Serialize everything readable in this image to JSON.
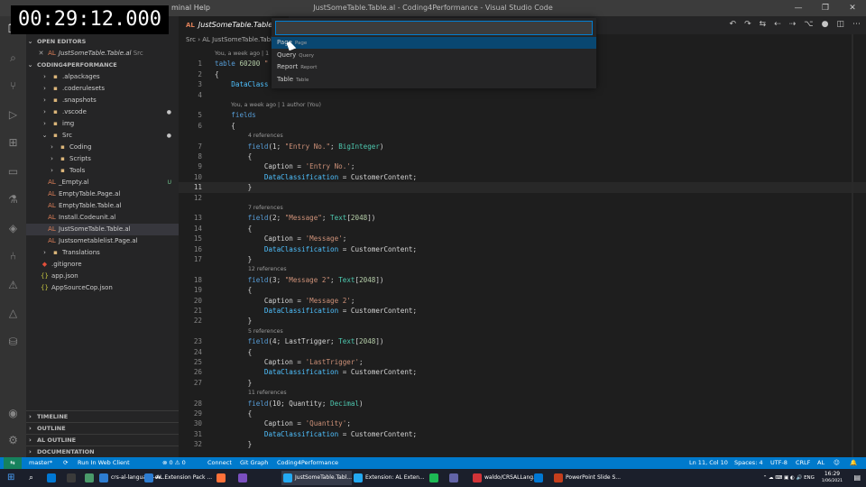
{
  "timer": "00:29:12.000",
  "titlebar": {
    "menu": "minal   Help",
    "title": "JustSomeTable.Table.al - Coding4Performance - Visual Studio Code",
    "controls": [
      "—",
      "❐",
      "✕"
    ]
  },
  "activity_icons": [
    "files-icon",
    "search-icon",
    "source-control-icon",
    "run-debug-icon",
    "extensions-icon",
    "remote-icon",
    "test-icon",
    "docker-icon",
    "git-graph-icon",
    "warning-icon",
    "triangle-icon",
    "database-icon",
    "account-icon",
    "settings-gear-icon"
  ],
  "sidebar": {
    "open_editors_header": "OPEN EDITORS",
    "open_editor": "JustSomeTable.Table.al",
    "open_editor_path": "Src",
    "workspace_header": "CODING4PERFORMANCE",
    "tree": [
      {
        "label": ".alpackages",
        "icon": "›",
        "kind": "folder"
      },
      {
        "label": ".coderulesets",
        "icon": "›",
        "kind": "folder"
      },
      {
        "label": ".snapshots",
        "icon": "›",
        "kind": "folder"
      },
      {
        "label": ".vscode",
        "icon": "›",
        "kind": "folder",
        "badge": "●"
      },
      {
        "label": "img",
        "icon": "›",
        "kind": "folder"
      },
      {
        "label": "Src",
        "icon": "⌄",
        "kind": "folder",
        "badge": "●"
      },
      {
        "label": "Coding",
        "icon": "›",
        "kind": "folder"
      },
      {
        "label": "Scripts",
        "icon": "›",
        "kind": "folder"
      },
      {
        "label": "Tools",
        "icon": "›",
        "kind": "folder"
      },
      {
        "label": "_Empty.al",
        "icon": "AL",
        "kind": "al",
        "badge": "U"
      },
      {
        "label": "EmptyTable.Page.al",
        "icon": "AL",
        "kind": "al"
      },
      {
        "label": "EmptyTable.Table.al",
        "icon": "AL",
        "kind": "al"
      },
      {
        "label": "Install.Codeunit.al",
        "icon": "AL",
        "kind": "al"
      },
      {
        "label": "JustSomeTable.Table.al",
        "icon": "AL",
        "kind": "al",
        "selected": true
      },
      {
        "label": "Justsometablelist.Page.al",
        "icon": "AL",
        "kind": "al"
      },
      {
        "label": "Translations",
        "icon": "›",
        "kind": "folder"
      },
      {
        "label": ".gitignore",
        "icon": "◆",
        "kind": "file"
      },
      {
        "label": "app.json",
        "icon": "{}",
        "kind": "json"
      },
      {
        "label": "AppSourceCop.json",
        "icon": "{}",
        "kind": "json"
      }
    ],
    "bottom_sections": [
      "TIMELINE",
      "OUTLINE",
      "AL OUTLINE",
      "DOCUMENTATION"
    ]
  },
  "editor": {
    "tab_prefix": "AL",
    "tab_label": "JustSomeTable.Table.al",
    "breadcrumb": "Src › AL JustSomeTable.Table.al",
    "actions": [
      "↶",
      "↷",
      "⇆",
      "⇠",
      "⇢",
      "⌥",
      "●",
      "◫",
      "⋯"
    ],
    "blame_top": "You, a week ago | 1",
    "blame_fields": "You, a week ago | 1 author (You)",
    "code": [
      {
        "n": "1",
        "parts": [
          [
            "kw",
            "table "
          ],
          [
            "num",
            "60200 "
          ],
          [
            "str",
            "\""
          ]
        ]
      },
      {
        "n": "2",
        "parts": [
          [
            "plain",
            "{"
          ]
        ]
      },
      {
        "n": "3",
        "parts": [
          [
            "plain",
            "    "
          ],
          [
            "prop",
            "DataClass"
          ]
        ]
      },
      {
        "n": "4",
        "parts": []
      },
      {
        "n": "5",
        "parts": [
          [
            "plain",
            "    "
          ],
          [
            "kw",
            "fields"
          ]
        ]
      },
      {
        "n": "6",
        "parts": [
          [
            "plain",
            "    {"
          ]
        ]
      },
      {
        "n": "7",
        "parts": [
          [
            "plain",
            "        "
          ],
          [
            "fn",
            "field"
          ],
          [
            "plain",
            "(1; "
          ],
          [
            "str",
            "\"Entry No.\""
          ],
          [
            "plain",
            "; "
          ],
          [
            "ty",
            "BigInteger"
          ],
          [
            "plain",
            ")"
          ]
        ]
      },
      {
        "n": "8",
        "parts": [
          [
            "plain",
            "        {"
          ]
        ]
      },
      {
        "n": "9",
        "parts": [
          [
            "plain",
            "            Caption = "
          ],
          [
            "str",
            "'Entry No.'"
          ],
          [
            "plain",
            ";"
          ]
        ]
      },
      {
        "n": "10",
        "parts": [
          [
            "plain",
            "            "
          ],
          [
            "prop",
            "DataClassification"
          ],
          [
            "plain",
            " = CustomerContent;"
          ]
        ]
      },
      {
        "n": "11",
        "parts": [
          [
            "plain",
            "        }"
          ]
        ]
      },
      {
        "n": "12",
        "parts": []
      },
      {
        "n": "13",
        "parts": [
          [
            "plain",
            "        "
          ],
          [
            "fn",
            "field"
          ],
          [
            "plain",
            "(2; "
          ],
          [
            "str",
            "\"Message\""
          ],
          [
            "plain",
            "; "
          ],
          [
            "ty",
            "Text"
          ],
          [
            "plain",
            "["
          ],
          [
            "num",
            "2048"
          ],
          [
            "plain",
            "])"
          ]
        ]
      },
      {
        "n": "14",
        "parts": [
          [
            "plain",
            "        {"
          ]
        ]
      },
      {
        "n": "15",
        "parts": [
          [
            "plain",
            "            Caption = "
          ],
          [
            "str",
            "'Message'"
          ],
          [
            "plain",
            ";"
          ]
        ]
      },
      {
        "n": "16",
        "parts": [
          [
            "plain",
            "            "
          ],
          [
            "prop",
            "DataClassification"
          ],
          [
            "plain",
            " = CustomerContent;"
          ]
        ]
      },
      {
        "n": "17",
        "parts": [
          [
            "plain",
            "        }"
          ]
        ]
      },
      {
        "n": "18",
        "parts": [
          [
            "plain",
            "        "
          ],
          [
            "fn",
            "field"
          ],
          [
            "plain",
            "(3; "
          ],
          [
            "str",
            "\"Message 2\""
          ],
          [
            "plain",
            "; "
          ],
          [
            "ty",
            "Text"
          ],
          [
            "plain",
            "["
          ],
          [
            "num",
            "2048"
          ],
          [
            "plain",
            "])"
          ]
        ]
      },
      {
        "n": "19",
        "parts": [
          [
            "plain",
            "        {"
          ]
        ]
      },
      {
        "n": "20",
        "parts": [
          [
            "plain",
            "            Caption = "
          ],
          [
            "str",
            "'Message 2'"
          ],
          [
            "plain",
            ";"
          ]
        ]
      },
      {
        "n": "21",
        "parts": [
          [
            "plain",
            "            "
          ],
          [
            "prop",
            "DataClassification"
          ],
          [
            "plain",
            " = CustomerContent;"
          ]
        ]
      },
      {
        "n": "22",
        "parts": [
          [
            "plain",
            "        }"
          ]
        ]
      },
      {
        "n": "23",
        "parts": [
          [
            "plain",
            "        "
          ],
          [
            "fn",
            "field"
          ],
          [
            "plain",
            "(4; LastTrigger; "
          ],
          [
            "ty",
            "Text"
          ],
          [
            "plain",
            "["
          ],
          [
            "num",
            "2048"
          ],
          [
            "plain",
            "])"
          ]
        ]
      },
      {
        "n": "24",
        "parts": [
          [
            "plain",
            "        {"
          ]
        ]
      },
      {
        "n": "25",
        "parts": [
          [
            "plain",
            "            Caption = "
          ],
          [
            "str",
            "'LastTrigger'"
          ],
          [
            "plain",
            ";"
          ]
        ]
      },
      {
        "n": "26",
        "parts": [
          [
            "plain",
            "            "
          ],
          [
            "prop",
            "DataClassification"
          ],
          [
            "plain",
            " = CustomerContent;"
          ]
        ]
      },
      {
        "n": "27",
        "parts": [
          [
            "plain",
            "        }"
          ]
        ]
      },
      {
        "n": "28",
        "parts": [
          [
            "plain",
            "        "
          ],
          [
            "fn",
            "field"
          ],
          [
            "plain",
            "(10; Quantity; "
          ],
          [
            "ty",
            "Decimal"
          ],
          [
            "plain",
            ")"
          ]
        ]
      },
      {
        "n": "29",
        "parts": [
          [
            "plain",
            "        {"
          ]
        ]
      },
      {
        "n": "30",
        "parts": [
          [
            "plain",
            "            Caption = "
          ],
          [
            "str",
            "'Quantity'"
          ],
          [
            "plain",
            ";"
          ]
        ]
      },
      {
        "n": "31",
        "parts": [
          [
            "plain",
            "            "
          ],
          [
            "prop",
            "DataClassification"
          ],
          [
            "plain",
            " = CustomerContent;"
          ]
        ]
      },
      {
        "n": "32",
        "parts": [
          [
            "plain",
            "        }"
          ]
        ]
      }
    ],
    "code_lens": [
      {
        "text": "4 references"
      },
      {
        "text": "7 references"
      },
      {
        "text": "12 references"
      },
      {
        "text": "5 references"
      },
      {
        "text": "11 references"
      }
    ]
  },
  "palette": {
    "input_value": "",
    "items": [
      {
        "label": "Page",
        "kind": "Page",
        "selected": true
      },
      {
        "label": "Query",
        "kind": "Query"
      },
      {
        "label": "Report",
        "kind": "Report"
      },
      {
        "label": "Table",
        "kind": "Table"
      }
    ]
  },
  "statusbar": {
    "branch": "master*",
    "sync": "⟳",
    "problems": "⊗ 0 ⚠ 0",
    "run_web": "Run In Web Client",
    "connect": "Connect",
    "git_graph": "Git Graph",
    "project": "Coding4Performance",
    "position": "Ln 11, Col 10",
    "spaces": "Spaces: 4",
    "encoding": "UTF-8",
    "eol": "CRLF",
    "language": "AL"
  },
  "taskbar": {
    "items": [
      {
        "label": "",
        "color": "#0078d4"
      },
      {
        "label": "",
        "color": "#3a3a3a"
      },
      {
        "label": "",
        "color": "#4a9a6a"
      },
      {
        "label": "crs-al-language-ex...",
        "color": "#2d7dd2"
      },
      {
        "label": "AL Extension Pack ...",
        "color": "#2d7dd2"
      },
      {
        "label": "",
        "color": "#ff7139"
      },
      {
        "label": "",
        "color": "#7a4fbf"
      },
      {
        "label": "JustSomeTable.Tabl...",
        "color": "#23a9f2",
        "active": true
      },
      {
        "label": "Extension: AL Exten...",
        "color": "#23a9f2"
      },
      {
        "label": "",
        "color": "#1db954"
      },
      {
        "label": "",
        "color": "#6264a7"
      },
      {
        "label": "waldo/CRSALLang...",
        "color": "#d13438"
      },
      {
        "label": "",
        "color": "#0078d4"
      },
      {
        "label": "PowerPoint Slide S...",
        "color": "#c43e1c"
      }
    ],
    "tray_icons": "⌃ ☁ ⌨ ▣ ◐ 🔊 ENG",
    "time": "16:29",
    "date": "1/06/2021"
  }
}
